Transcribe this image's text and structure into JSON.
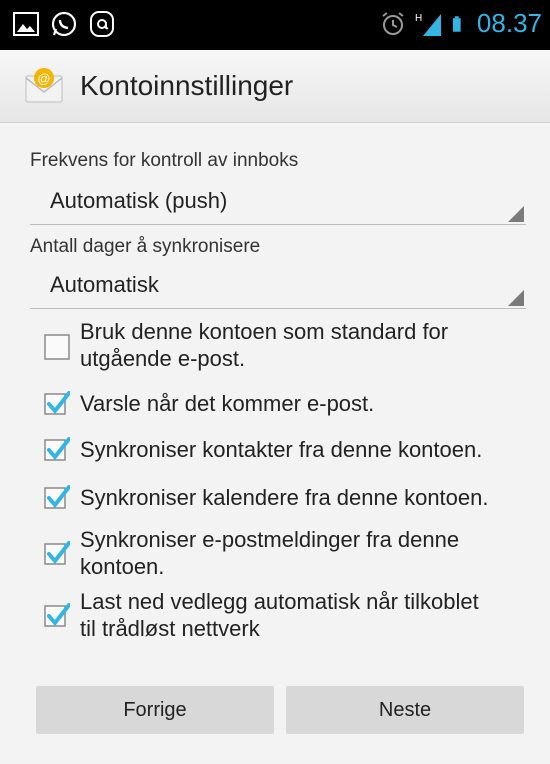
{
  "status_bar": {
    "left_icons": [
      "gallery-icon",
      "whatsapp-icon",
      "at-app-icon"
    ],
    "right_icons": [
      "alarm-icon",
      "signal-icon",
      "battery-icon"
    ],
    "time": "08.37",
    "accent_color": "#33b5e5"
  },
  "action_bar": {
    "icon": "email-envelope-icon",
    "title": "Kontoinnstillinger"
  },
  "settings": {
    "frequency_label": "Frekvens for kontroll av innboks",
    "frequency_value": "Automatisk (push)",
    "sync_days_label": "Antall dager å synkronisere",
    "sync_days_value": "Automatisk"
  },
  "checkboxes": [
    {
      "label_line1": "Bruk denne kontoen som standard for",
      "label_line2": "utgående e-post.",
      "checked": false
    },
    {
      "label_line1": "Varsle når det kommer e-post.",
      "checked": true
    },
    {
      "label_line1": "Synkroniser kontakter fra denne kontoen.",
      "checked": true
    },
    {
      "label_line1": "Synkroniser kalendere fra denne kontoen.",
      "checked": true
    },
    {
      "label_line1": "Synkroniser e-postmeldinger fra denne",
      "label_line2": "kontoen.",
      "checked": true
    },
    {
      "label_line1": "Last ned vedlegg automatisk når tilkoblet",
      "label_line2": "til trådløst nettverk",
      "checked": true
    }
  ],
  "buttons": {
    "previous": "Forrige",
    "next": "Neste"
  }
}
